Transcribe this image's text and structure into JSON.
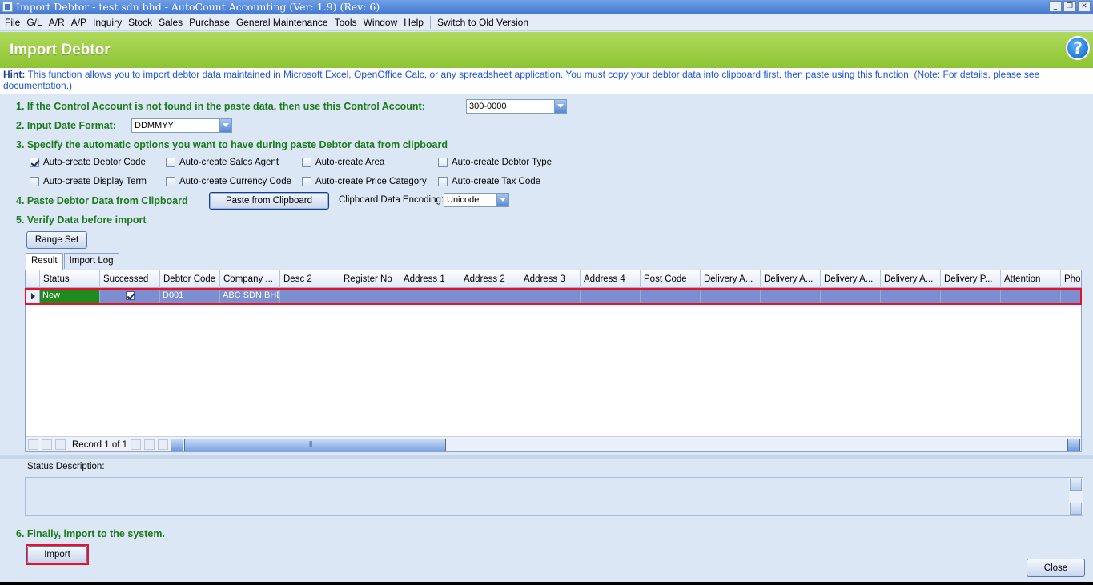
{
  "window": {
    "title": "Import Debtor - test sdn bhd - AutoCount Accounting (Ver: 1.9) (Rev: 6)",
    "controls": [
      "_",
      "❐",
      "✕"
    ]
  },
  "menu": {
    "items": [
      "File",
      "G/L",
      "A/R",
      "A/P",
      "Inquiry",
      "Stock",
      "Sales",
      "Purchase",
      "General Maintenance",
      "Tools",
      "Window",
      "Help"
    ],
    "switch_label": "Switch to Old Version"
  },
  "header": {
    "title": "Import Debtor",
    "help": "?"
  },
  "hint": {
    "label": "Hint:",
    "text": " This function allows you to import debtor data maintained in Microsoft Excel, OpenOffice Calc, or any spreadsheet application. You must copy your debtor data into clipboard first, then paste using this function. (Note: For details, please see documentation.)"
  },
  "steps": {
    "s1": "1. If the Control Account is not found in the paste data, then use this Control Account:",
    "s2": "2. Input Date Format:",
    "s3": "3. Specify the automatic options you want to have during paste Debtor data from clipboard",
    "s4": "4. Paste Debtor Data from Clipboard",
    "s5": "5. Verify Data before import",
    "s6": "6. Finally, import to the system."
  },
  "control_account": {
    "value": "300-0000"
  },
  "date_format": {
    "value": "DDMMYY"
  },
  "options": [
    {
      "label": "Auto-create Debtor Code",
      "checked": true
    },
    {
      "label": "Auto-create Sales Agent",
      "checked": false
    },
    {
      "label": "Auto-create Area",
      "checked": false
    },
    {
      "label": "Auto-create Debtor Type",
      "checked": false
    },
    {
      "label": "Auto-create Display Term",
      "checked": false
    },
    {
      "label": "Auto-create Currency Code",
      "checked": false
    },
    {
      "label": "Auto-create Price Category",
      "checked": false
    },
    {
      "label": "Auto-create Tax Code",
      "checked": false
    }
  ],
  "paste": {
    "button": "Paste from Clipboard",
    "encoding_label": "Clipboard Data Encoding:",
    "encoding_value": "Unicode"
  },
  "range_set_button": "Range Set",
  "tabs": [
    {
      "label": "Result",
      "active": true
    },
    {
      "label": "Import Log",
      "active": false
    }
  ],
  "grid": {
    "columns": [
      "Status",
      "Successed",
      "Debtor Code",
      "Company ...",
      "Desc 2",
      "Register No",
      "Address 1",
      "Address 2",
      "Address 3",
      "Address 4",
      "Post Code",
      "Delivery A...",
      "Delivery A...",
      "Delivery A...",
      "Delivery A...",
      "Delivery P...",
      "Attention",
      "Phon"
    ],
    "rows": [
      {
        "status": "New",
        "successed": true,
        "debtor_code": "D001",
        "company": "ABC SDN BHD"
      }
    ],
    "record_label": "Record 1 of 1"
  },
  "status_description": {
    "label": "Status Description:"
  },
  "buttons": {
    "import": "Import",
    "close": "Close"
  },
  "colors": {
    "accent_green": "#8dc434",
    "step_text": "#1d7a1d",
    "highlight": "#e8102a",
    "row_selected": "#7b8fd0"
  }
}
